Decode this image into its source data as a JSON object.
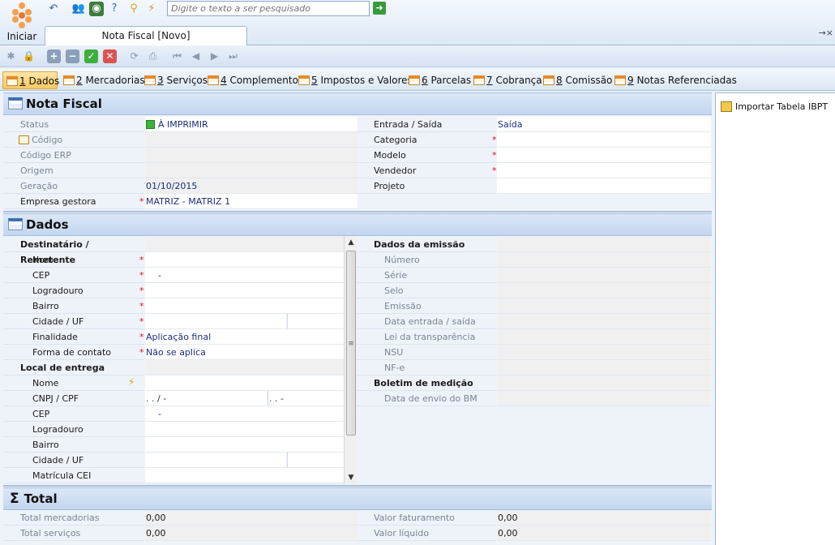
{
  "app": {
    "start_label": "Iniciar",
    "search_placeholder": "Digite o texto a ser pesquisado",
    "doc_tab": "Nota Fiscal [Novo]",
    "tab_controls": "→×"
  },
  "form_tabs": [
    {
      "num": "1",
      "label": " Dados"
    },
    {
      "num": "2",
      "label": " Mercadorias"
    },
    {
      "num": "3",
      "label": " Serviços"
    },
    {
      "num": "4",
      "label": " Complemento"
    },
    {
      "num": "5",
      "label": " Impostos e Valores"
    },
    {
      "num": "6",
      "label": " Parcelas"
    },
    {
      "num": "7",
      "label": " Cobrança"
    },
    {
      "num": "8",
      "label": " Comissão"
    },
    {
      "num": "9",
      "label": " Notas Referenciadas"
    }
  ],
  "nota_fiscal": {
    "title": "Nota Fiscal",
    "status_label": "Status",
    "status_value": "À IMPRIMIR",
    "codigo_label": "Código",
    "codigo_erp_label": "Código ERP",
    "origem_label": "Origem",
    "geracao_label": "Geração",
    "geracao_value": "01/10/2015",
    "empresa_label": "Empresa gestora",
    "empresa_value": "MATRIZ - MATRIZ 1",
    "entrada_saida_label": "Entrada / Saída",
    "entrada_saida_value": "Saída",
    "categoria_label": "Categoria",
    "modelo_label": "Modelo",
    "vendedor_label": "Vendedor",
    "projeto_label": "Projeto"
  },
  "dados": {
    "title": "Dados",
    "dest_title": "Destinatário / Remetente",
    "nome": "Nome",
    "cep": "CEP",
    "cep_value": "-",
    "logradouro": "Logradouro",
    "bairro": "Bairro",
    "cidade_uf": "Cidade / UF",
    "finalidade": "Finalidade",
    "finalidade_value": "Aplicação final",
    "forma_contato": "Forma de contato",
    "forma_contato_value": "Não se aplica",
    "local_title": "Local de entrega",
    "local_nome": "Nome",
    "cnpj_cpf": "CNPJ / CPF",
    "cnpj_mask": " .  .  /   -",
    "cpf_mask": " .  .  -",
    "local_cep": "CEP",
    "local_cep_value": "-",
    "local_logradouro": "Logradouro",
    "local_bairro": "Bairro",
    "local_cidade_uf": "Cidade / UF",
    "matricula": "Matrícula CEI",
    "emissao_title": "Dados da emissão",
    "numero": "Número",
    "serie": "Série",
    "selo": "Selo",
    "emissao": "Emissão",
    "data_entrada_saida": "Data entrada / saída",
    "lei_transparencia": "Lei da transparência",
    "nsu": "NSU",
    "nfe": "NF-e",
    "boletim_title": "Boletim de medição",
    "data_envio_bm": "Data de envio do BM"
  },
  "total": {
    "title": "Total",
    "mercadorias_label": "Total mercadorias",
    "mercadorias_value": "0,00",
    "servicos_label": "Total serviços",
    "servicos_value": "0,00",
    "faturamento_label": "Valor faturamento",
    "faturamento_value": "0,00",
    "liquido_label": "Valor líquido",
    "liquido_value": "0,00"
  },
  "side": {
    "import_label": "Importar Tabela IBPT"
  }
}
